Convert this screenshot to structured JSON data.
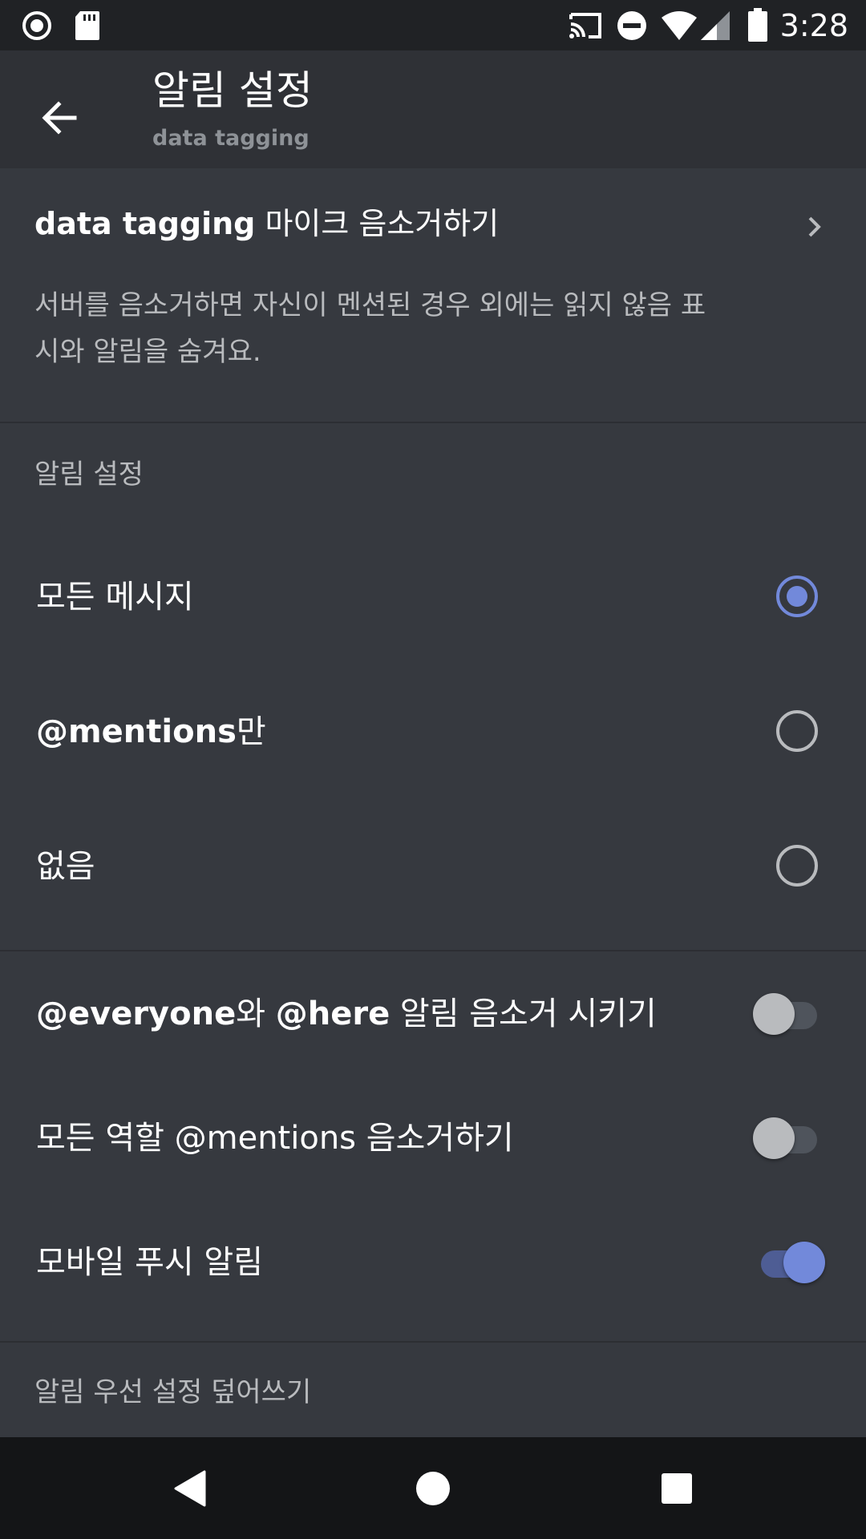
{
  "status_bar": {
    "time": "3:28",
    "icons": [
      "record-icon",
      "sd-card-icon",
      "cast-icon",
      "do-not-disturb-icon",
      "wifi-icon",
      "signal-icon",
      "battery-icon"
    ]
  },
  "app_bar": {
    "title": "알림 설정",
    "subtitle": "data tagging",
    "back_icon": "arrow-left-icon"
  },
  "mute_server": {
    "server_name": "data tagging",
    "label_suffix": " 마이크 음소거하기",
    "description": "서버를 음소거하면 자신이 멘션된 경우 외에는 읽지 않음 표시와 알림을 숨겨요."
  },
  "notification_settings": {
    "header": "알림 설정",
    "options": [
      {
        "label": "모든 메시지",
        "selected": true
      },
      {
        "label_bold": "@mentions",
        "label_suffix": "만",
        "selected": false
      },
      {
        "label": "없음",
        "selected": false
      }
    ]
  },
  "toggles": [
    {
      "label_bold_1": "@everyone",
      "label_mid": "와 ",
      "label_bold_2": "@here",
      "label_suffix": " 알림 음소거 시키기",
      "on": false
    },
    {
      "label": "모든 역할 @mentions 음소거하기",
      "on": false
    },
    {
      "label": "모바일 푸시 알림",
      "on": true
    }
  ],
  "overrides": {
    "header": "알림 우선 설정 덮어쓰기"
  },
  "colors": {
    "accent": "#7289da",
    "background": "#36393f",
    "app_bar": "#2f3136",
    "status_bar": "#202225"
  }
}
